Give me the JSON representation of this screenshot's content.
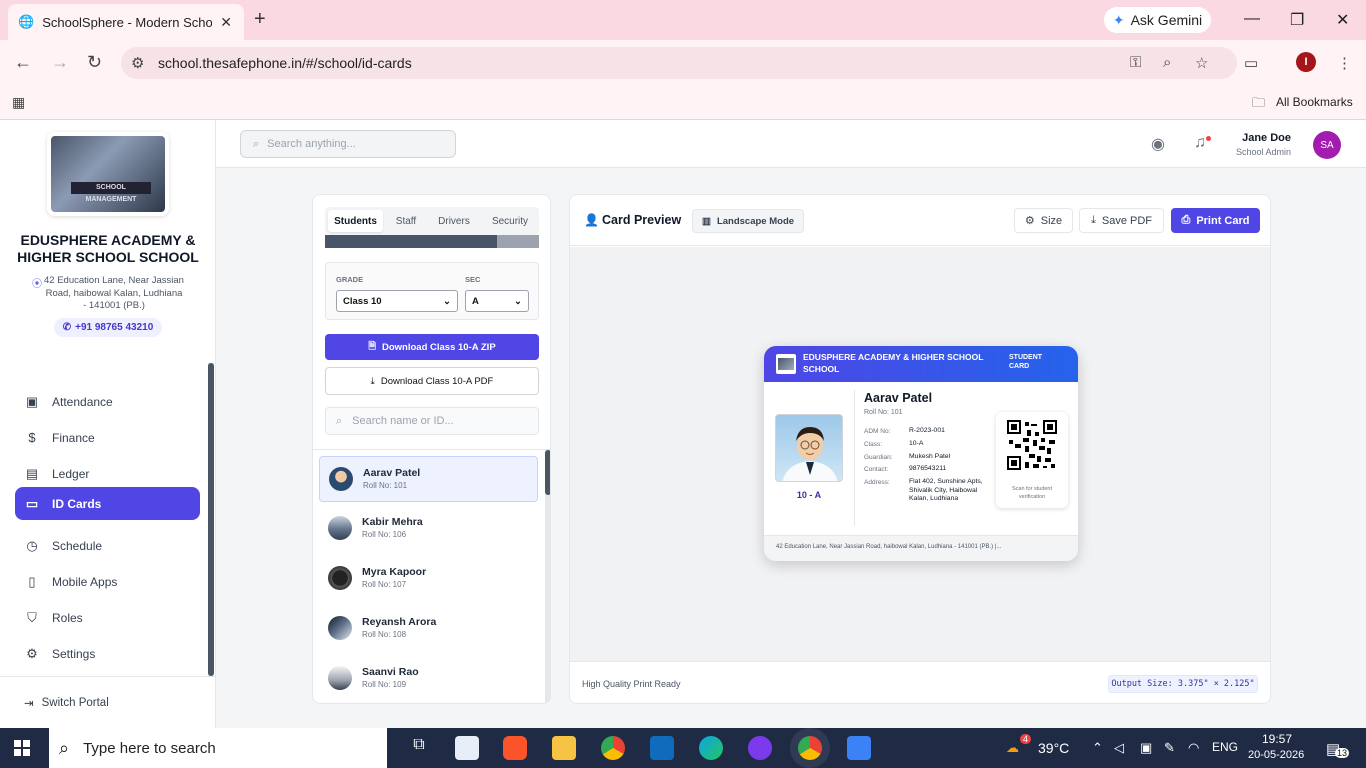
{
  "browser": {
    "tab_title": "SchoolSphere - Modern School",
    "url": "school.thesafephone.in/#/school/id-cards",
    "gemini_label": "Ask Gemini",
    "bookmarks_label": "All Bookmarks",
    "profile_initial": "I"
  },
  "sidebar": {
    "school_name": "EDUSPHERE ACADEMY & HIGHER SCHOOL SCHOOL",
    "logo_text": "SCHOOL MANAGEMENT",
    "address": "42 Education Lane, Near Jassian Road, haibowal Kalan, Ludhiana - 141001 (PB.)",
    "phone": "+91 98765 43210",
    "items": [
      {
        "label": "Attendance",
        "icon": "calendar-check-icon"
      },
      {
        "label": "Finance",
        "icon": "dollar-icon"
      },
      {
        "label": "Ledger",
        "icon": "book-icon"
      },
      {
        "label": "ID Cards",
        "icon": "id-card-icon",
        "active": true
      },
      {
        "label": "Schedule",
        "icon": "clock-icon"
      },
      {
        "label": "Mobile Apps",
        "icon": "smartphone-icon"
      },
      {
        "label": "Roles",
        "icon": "shield-icon"
      },
      {
        "label": "Settings",
        "icon": "gear-icon"
      }
    ],
    "switch_label": "Switch Portal"
  },
  "topbar": {
    "search_placeholder": "Search anything...",
    "user_name": "Jane Doe",
    "user_role": "School Admin",
    "user_initials": "SA"
  },
  "left_panel": {
    "tabs": [
      "Students",
      "Staff",
      "Drivers",
      "Security"
    ],
    "active_tab": "Students",
    "grade_label": "GRADE",
    "grade_value": "Class 10",
    "sec_label": "SEC",
    "sec_value": "A",
    "zip_button": "Download Class 10-A ZIP",
    "pdf_button": "Download Class 10-A PDF",
    "search_placeholder": "Search name or ID...",
    "students": [
      {
        "name": "Aarav Patel",
        "roll": "Roll No: 101"
      },
      {
        "name": "Kabir Mehra",
        "roll": "Roll No: 106"
      },
      {
        "name": "Myra Kapoor",
        "roll": "Roll No: 107"
      },
      {
        "name": "Reyansh Arora",
        "roll": "Roll No: 108"
      },
      {
        "name": "Saanvi Rao",
        "roll": "Roll No: 109"
      }
    ]
  },
  "preview": {
    "title": "Card Preview",
    "landscape_button": "Landscape Mode",
    "size_button": "Size",
    "save_button": "Save PDF",
    "print_button": "Print Card",
    "footer_left": "High Quality Print Ready",
    "footer_right": "Output Size: 3.375\" × 2.125\""
  },
  "card": {
    "school": "EDUSPHERE ACADEMY & HIGHER SCHOOL SCHOOL",
    "tag": "STUDENT CARD",
    "name": "Aarav Patel",
    "roll": "Roll No: 101",
    "class_section": "10 - A",
    "fields": [
      {
        "k": "ADM No:",
        "v": "R-2023-001"
      },
      {
        "k": "Class:",
        "v": "10-A"
      },
      {
        "k": "Guardian:",
        "v": "Mukesh Patel"
      },
      {
        "k": "Contact:",
        "v": "9876543211"
      },
      {
        "k": "Address:",
        "v": "Flat 402, Sunshine Apts, Shivalik City, Haibowal Kalan, Ludhiana"
      }
    ],
    "scan_label": "Scan for student verification",
    "footer": "42 Education Lane, Near Jassian Road, haibowal Kalan, Ludhiana - 141001 (PB.) |..."
  },
  "taskbar": {
    "search_placeholder": "Type here to search",
    "temperature": "39°C",
    "language": "ENG",
    "time": "19:57",
    "date": "20-05-2026",
    "notif_count": "13",
    "weather_badge": "4"
  },
  "colors": {
    "accent": "#4f46e5",
    "tab_bar": "#fbd9e3",
    "taskbar": "#1f2a44"
  }
}
